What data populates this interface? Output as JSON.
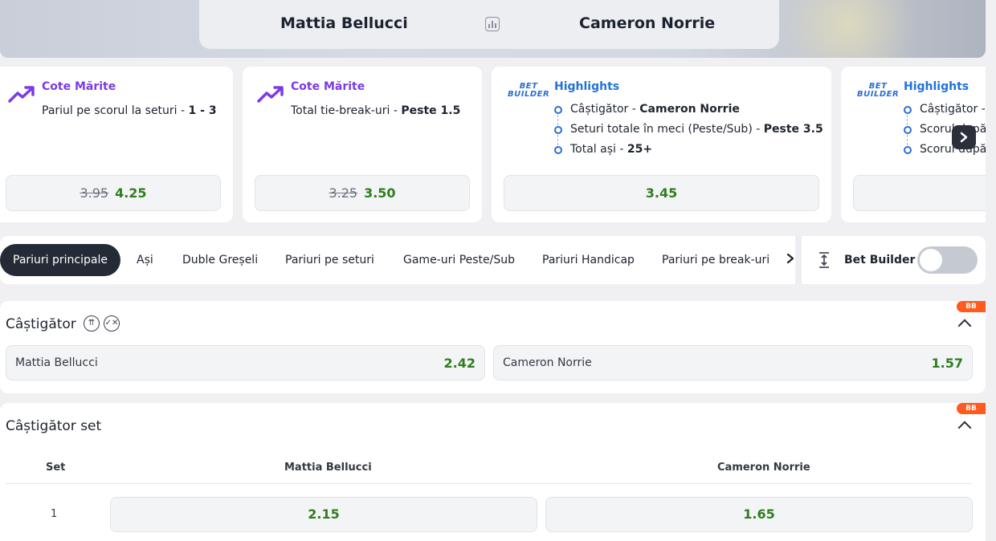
{
  "header": {
    "home_team": "Mattia Bellucci",
    "away_team": "Cameron Norrie",
    "stats_icon": "bar-chart-icon"
  },
  "promos": [
    {
      "type": "Cote Mărite",
      "desc_prefix": "Pariul pe scorul la seturi - ",
      "desc_value": "1 - 3",
      "old_odds": "3.95",
      "new_odds": "4.25"
    },
    {
      "type": "Cote Mărite",
      "desc_prefix": "Total tie-break-uri - ",
      "desc_value": "Peste 1.5",
      "old_odds": "3.25",
      "new_odds": "3.50"
    },
    {
      "type": "Highlights",
      "logo_line1": "BET",
      "logo_line2": "BUILDER",
      "items": [
        {
          "prefix": "Câștigător - ",
          "value": "Cameron Norrie"
        },
        {
          "prefix": "Seturi totale în meci (Peste/Sub) - ",
          "value": "Peste 3.5"
        },
        {
          "prefix": "Total ași - ",
          "value": "25+"
        }
      ],
      "odds": "3.45"
    },
    {
      "type": "Highlights",
      "logo_line1": "BET",
      "logo_line2": "BUILDER",
      "items": [
        {
          "prefix": "Câștigător - ",
          "value": ""
        },
        {
          "prefix": "Scorul după",
          "value": ""
        },
        {
          "prefix": "Scorul după",
          "value": ""
        }
      ]
    }
  ],
  "tabs": [
    "Pariuri principale",
    "Ași",
    "Duble Greșeli",
    "Pariuri pe seturi",
    "Game-uri Peste/Sub",
    "Pariuri Handicap",
    "Pariuri pe break-uri"
  ],
  "bet_builder": {
    "label": "Bet Builder",
    "enabled": false
  },
  "markets": {
    "winner": {
      "title": "Câștigător",
      "badge": "BB",
      "selections": [
        {
          "name": "Mattia Bellucci",
          "odds": "2.42"
        },
        {
          "name": "Cameron Norrie",
          "odds": "1.57"
        }
      ]
    },
    "set_winner": {
      "title": "Câștigător set",
      "badge": "BB",
      "columns": [
        "Set",
        "Mattia Bellucci",
        "Cameron Norrie"
      ],
      "rows": [
        {
          "set": "1",
          "home": "2.15",
          "away": "1.65"
        }
      ]
    }
  },
  "colors": {
    "accent_odds": "#2f7d1f",
    "boost_purple": "#7d3ae6",
    "highlight_blue": "#2073d6",
    "badge_orange": "#ff5a1f"
  }
}
